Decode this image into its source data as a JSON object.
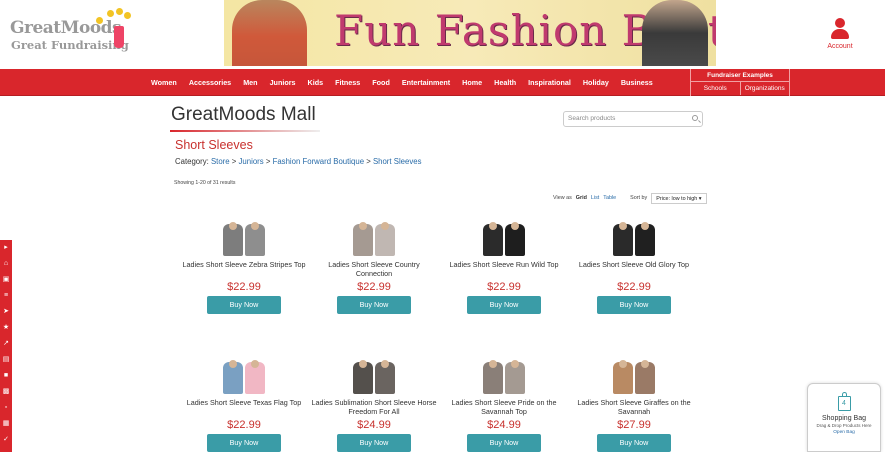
{
  "header": {
    "logo_line1": "GreatMoods",
    "logo_line2": "Great Fundraising",
    "banner_text": "Fun Fashion Boutique",
    "account_label": "Account"
  },
  "nav": {
    "items": [
      "Women",
      "Accessories",
      "Men",
      "Juniors",
      "Kids",
      "Fitness",
      "Food",
      "Entertainment",
      "Home",
      "Health",
      "Inspirational",
      "Holiday",
      "Business"
    ],
    "fundraiser": {
      "title": "Fundraiser Examples",
      "schools": "Schools",
      "organizations": "Organizations"
    }
  },
  "mall": {
    "title": "GreatMoods Mall",
    "search_placeholder": "Search products"
  },
  "category": {
    "title": "Short Sleeves",
    "label": "Category:",
    "crumbs": [
      "Store",
      "Juniors",
      "Fashion Forward Boutique",
      "Short Sleeves"
    ],
    "separator": ">",
    "results": "Showing 1-20 of 31 results"
  },
  "view": {
    "label": "View as",
    "grid": "Grid",
    "list": "List",
    "table": "Table",
    "sort_label": "Sort by",
    "sort_value": "Price: low to high"
  },
  "products": [
    {
      "name": "Ladies Short Sleeve Zebra Stripes Top",
      "price": "$22.99",
      "buy": "Buy Now",
      "c1": "#7d7d7d",
      "c2": "#8e8e8e"
    },
    {
      "name": "Ladies Short Sleeve Country Connection",
      "price": "$22.99",
      "buy": "Buy Now",
      "c1": "#a59a92",
      "c2": "#c0b7b2"
    },
    {
      "name": "Ladies Short Sleeve Run Wild Top",
      "price": "$22.99",
      "buy": "Buy Now",
      "c1": "#2b2b2b",
      "c2": "#1e1e1e"
    },
    {
      "name": "Ladies Short Sleeve Old Glory Top",
      "price": "$22.99",
      "buy": "Buy Now",
      "c1": "#2a2a2a",
      "c2": "#202020"
    },
    {
      "name": "Ladies Short Sleeve Texas Flag Top",
      "price": "$22.99",
      "buy": "Buy Now",
      "c1": "#7aa0c2",
      "c2": "#f1b7c4"
    },
    {
      "name": "Ladies Sublimation Short Sleeve Horse Freedom For All",
      "price": "$24.99",
      "buy": "Buy Now",
      "c1": "#54504c",
      "c2": "#6a6460"
    },
    {
      "name": "Ladies Short Sleeve Pride on the Savannah Top",
      "price": "$24.99",
      "buy": "Buy Now",
      "c1": "#8a7f78",
      "c2": "#a49a92"
    },
    {
      "name": "Ladies Short Sleeve Giraffes on the Savannah",
      "price": "$27.99",
      "buy": "Buy Now",
      "c1": "#b98a63",
      "c2": "#9a7a66"
    }
  ],
  "bag": {
    "count": "4",
    "title": "Shopping Bag",
    "hint": "Drag & Drop Products Here",
    "open": "Open Bag"
  },
  "sidebar_icons": [
    "chevron-right-icon",
    "home-icon",
    "monitor-icon",
    "list-icon",
    "cursor-icon",
    "star-icon",
    "chart-icon",
    "cart-icon",
    "truck-icon",
    "cash-icon",
    "box-icon",
    "calendar-icon",
    "check-icon"
  ],
  "colors": {
    "brand_red": "#d9262c",
    "button_teal": "#3a9ca7",
    "price_red": "#c8312e",
    "link_blue": "#2a6ca8"
  }
}
